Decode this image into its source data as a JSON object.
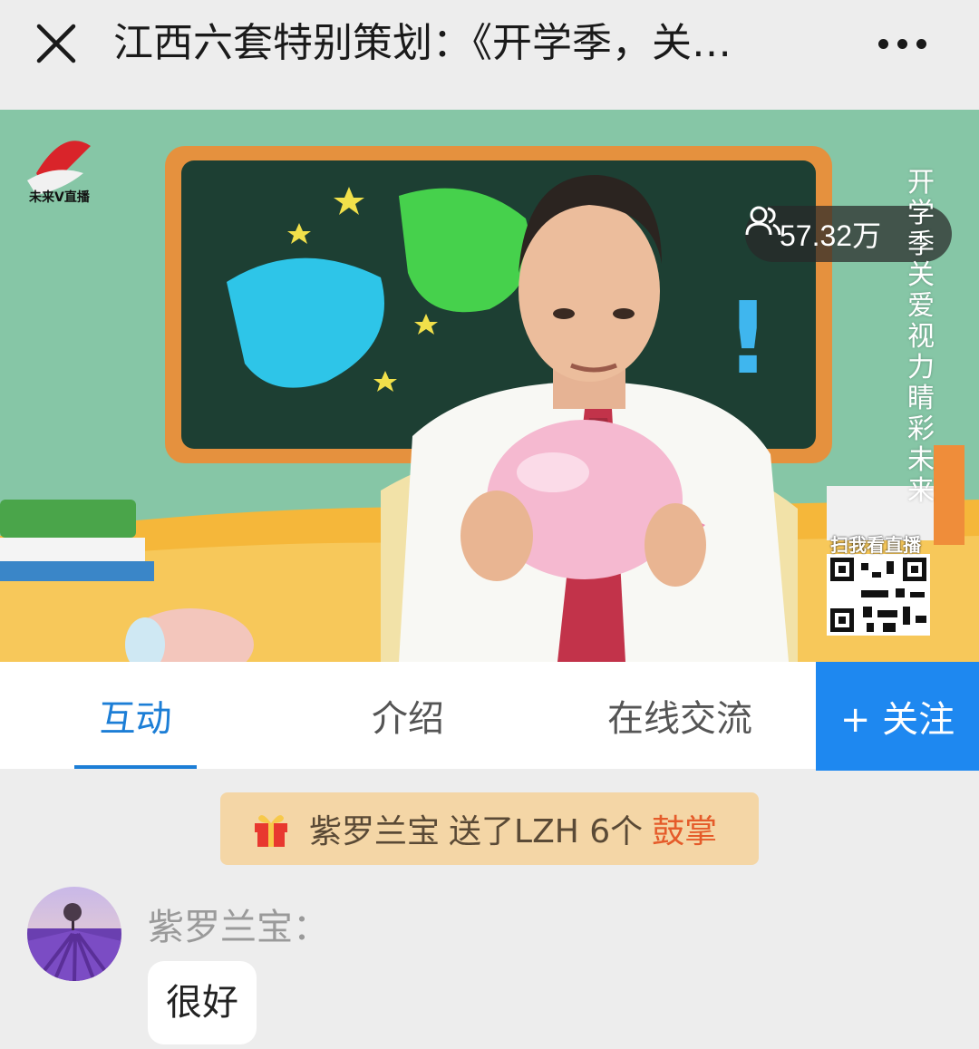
{
  "header": {
    "title": "江西六套特别策划：《开学季，关…",
    "close_icon": "close-icon",
    "more_icon": "more-horizontal-icon"
  },
  "video": {
    "channel_logo_text": "未来V直播",
    "viewer_count": "57.32万",
    "viewer_icon": "users-icon",
    "vertical_caption": "开学季\n关爱视力\n睛彩未来",
    "qr_label": "扫我看直播"
  },
  "tabs": [
    {
      "label": "互动",
      "active": true
    },
    {
      "label": "介绍",
      "active": false
    },
    {
      "label": "在线交流",
      "active": false
    }
  ],
  "follow_button": {
    "label": "+ 关注"
  },
  "gift_notice": {
    "icon": "gift-icon",
    "sender": "紫罗兰宝",
    "action": "送了LZH 6个",
    "item": "鼓掌"
  },
  "comments": [
    {
      "user": "紫罗兰宝：",
      "text": "很好"
    }
  ],
  "colors": {
    "accent": "#1c7ed6",
    "follow_bg": "#1e88f0",
    "gift_bg": "#f4d6a6",
    "gift_item": "#e55b2a"
  }
}
